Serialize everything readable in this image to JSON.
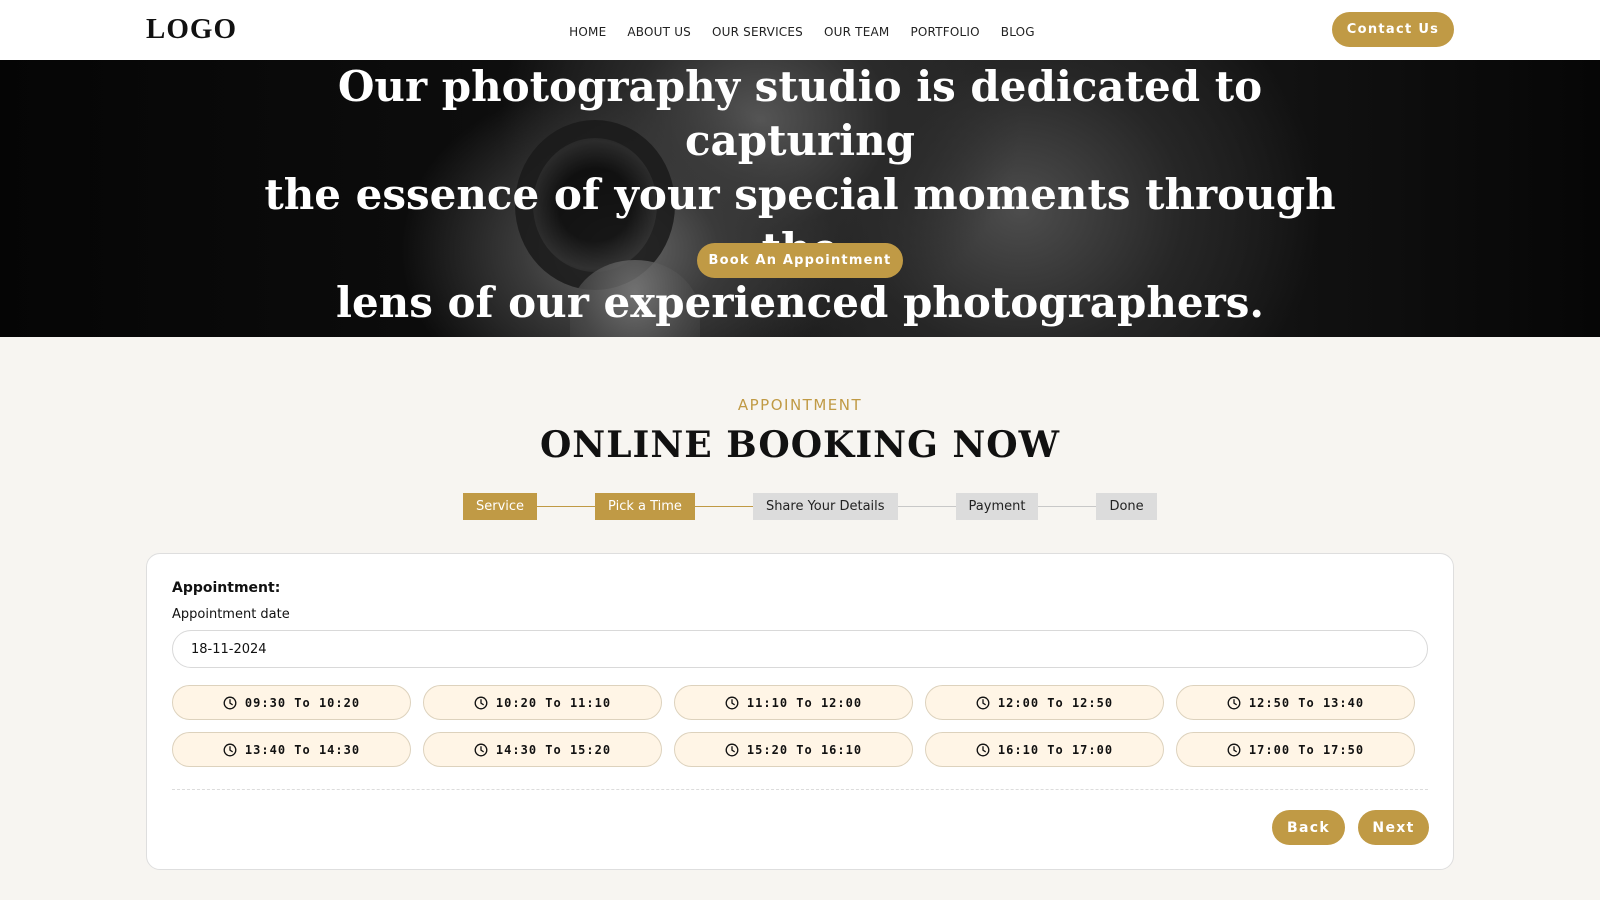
{
  "header": {
    "logo": "LOGO",
    "nav": [
      "HOME",
      "ABOUT US",
      "OUR SERVICES",
      "OUR TEAM",
      "PORTFOLIO",
      "BLOG"
    ],
    "contact_label": "Contact Us"
  },
  "hero": {
    "heading_lines": [
      "Our photography studio is dedicated to capturing",
      "the essence of your special moments through the",
      "lens of our experienced photographers."
    ],
    "cta_label": "Book An Appointment"
  },
  "booking": {
    "subtitle": "APPOINTMENT",
    "title": "ONLINE BOOKING NOW",
    "steps": [
      {
        "label": "Service",
        "active": true
      },
      {
        "label": "Pick a Time",
        "active": true
      },
      {
        "label": "Share Your Details",
        "active": false
      },
      {
        "label": "Payment",
        "active": false
      },
      {
        "label": "Done",
        "active": false
      }
    ],
    "card_heading": "Appointment:",
    "date_label": "Appointment date",
    "date_value": "18-11-2024",
    "slots": [
      "09:30 To 10:20",
      "10:20 To 11:10",
      "11:10 To 12:00",
      "12:00 To 12:50",
      "12:50 To 13:40",
      "13:40 To 14:30",
      "14:30 To 15:20",
      "15:20 To 16:10",
      "16:10 To 17:00",
      "17:00 To 17:50"
    ],
    "slot_icon": "clock-icon",
    "back_label": "Back",
    "next_label": "Next"
  },
  "colors": {
    "accent": "#c09a45",
    "slot_bg": "#fff5e6",
    "step_inactive": "#dcdcdc"
  }
}
